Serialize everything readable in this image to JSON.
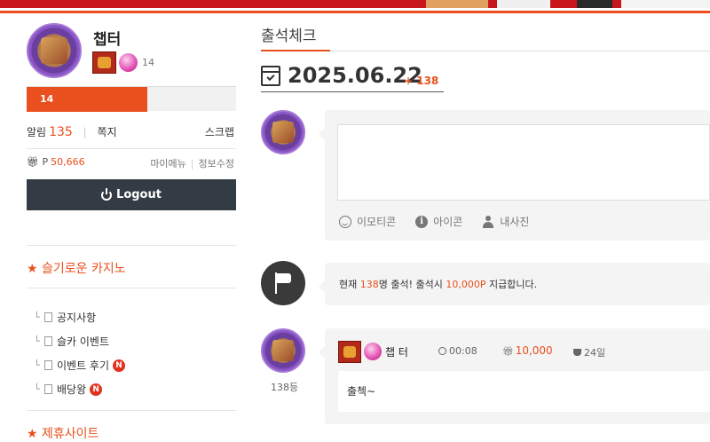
{
  "sidebar": {
    "nickname": "챕터",
    "level_number": "14",
    "level_bar_label": "14",
    "level_progress": 0.57,
    "alarm_label": "알림",
    "alarm_count": "135",
    "message_label": "쪽지",
    "scrap_label": "스크랩",
    "point_icon": "gift-icon",
    "point_prefix": "P",
    "point_value": "50,666",
    "my_menu_label": "마이메뉴",
    "edit_info_label": "정보수정",
    "logout_label": "Logout",
    "menu_section_title": "★ 슬기로운 카지노",
    "menu_items": [
      {
        "label": "공지사항",
        "new": false
      },
      {
        "label": "슬카 이벤트",
        "new": false
      },
      {
        "label": "이벤트 후기",
        "new": true,
        "new_label": "N"
      },
      {
        "label": "배당왕",
        "new": true,
        "new_label": "N"
      }
    ],
    "partner_section_title": "★ 제휴사이트"
  },
  "main": {
    "tab_label": "출석체크",
    "date": "2025.06.22",
    "date_count": "+ 138",
    "write_tools": [
      {
        "icon": "smile-icon",
        "label": "이모티콘"
      },
      {
        "icon": "info-icon",
        "label": "아이콘"
      },
      {
        "icon": "user-icon",
        "label": "내사진"
      }
    ],
    "notice": {
      "prefix": "현재 ",
      "count": "138",
      "middle": "명 출석! 출석시 ",
      "reward": "10,000P",
      "suffix": " 지급합니다."
    },
    "entry": {
      "rank": "138등",
      "name": "챕 터",
      "time": "00:08",
      "points": "10,000",
      "days": "24일",
      "comment": "출첵~"
    }
  },
  "colors": {
    "accent": "#e9501d",
    "logout_bg": "#333b45",
    "banner_red": "#c8161d"
  }
}
